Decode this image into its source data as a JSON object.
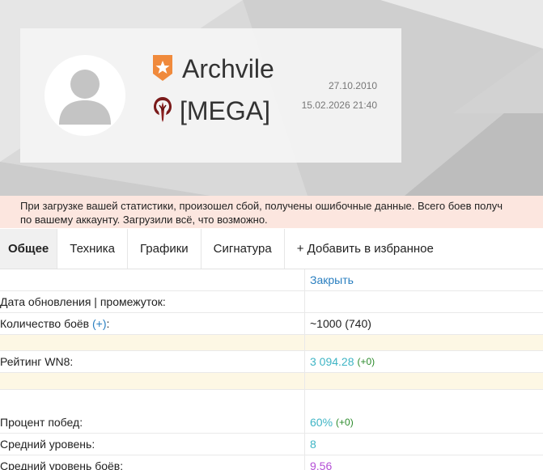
{
  "colors": {
    "accent_link": "#2a7fc0",
    "stat_teal": "#3fb5c5",
    "stat_purple": "#b44fd6",
    "delta_green": "#2b8a2b",
    "warning_bg": "#fce6df",
    "spacer_row_bg": "#fdf7e4",
    "badge_orange": "#f08a3c"
  },
  "profile": {
    "nickname": "Archvile",
    "clan_tag": "[MEGA]",
    "registered_date": "27.10.2010",
    "last_battle_date": "15.02.2026 21:40",
    "avatar_icon": "user-avatar-icon",
    "badge_icon": "star-badge-icon",
    "clan_icon": "clan-emblem-icon"
  },
  "warning": {
    "line1": "При загрузке вашей статистики, произошел сбой, получены ошибочные данные. Всего боев получ",
    "line2": "по вашему аккаунту. Загрузили всё, что возможно."
  },
  "tabs": {
    "general": "Общее",
    "vehicles": "Техника",
    "charts": "Графики",
    "signature": "Сигнатура",
    "favorite": "+ Добавить в избранное"
  },
  "table": {
    "close_link": "Закрыть",
    "update_label": "Дата обновления | промежуток:",
    "update_value": "",
    "battles_label": "Количество боёв",
    "battles_plus": "(+)",
    "battles_colon": ":",
    "battles_value": "~1000 (740)",
    "wn8_label": "Рейтинг WN8:",
    "wn8_value": "3 094.28",
    "wn8_delta": "(+0)",
    "winrate_label": "Процент побед:",
    "winrate_value": "60%",
    "winrate_delta": "(+0)",
    "avg_tier_label": "Средний уровень:",
    "avg_tier_value": "8",
    "avg_battle_tier_label": "Средний уровень боёв:",
    "avg_battle_tier_value": "9.56"
  }
}
